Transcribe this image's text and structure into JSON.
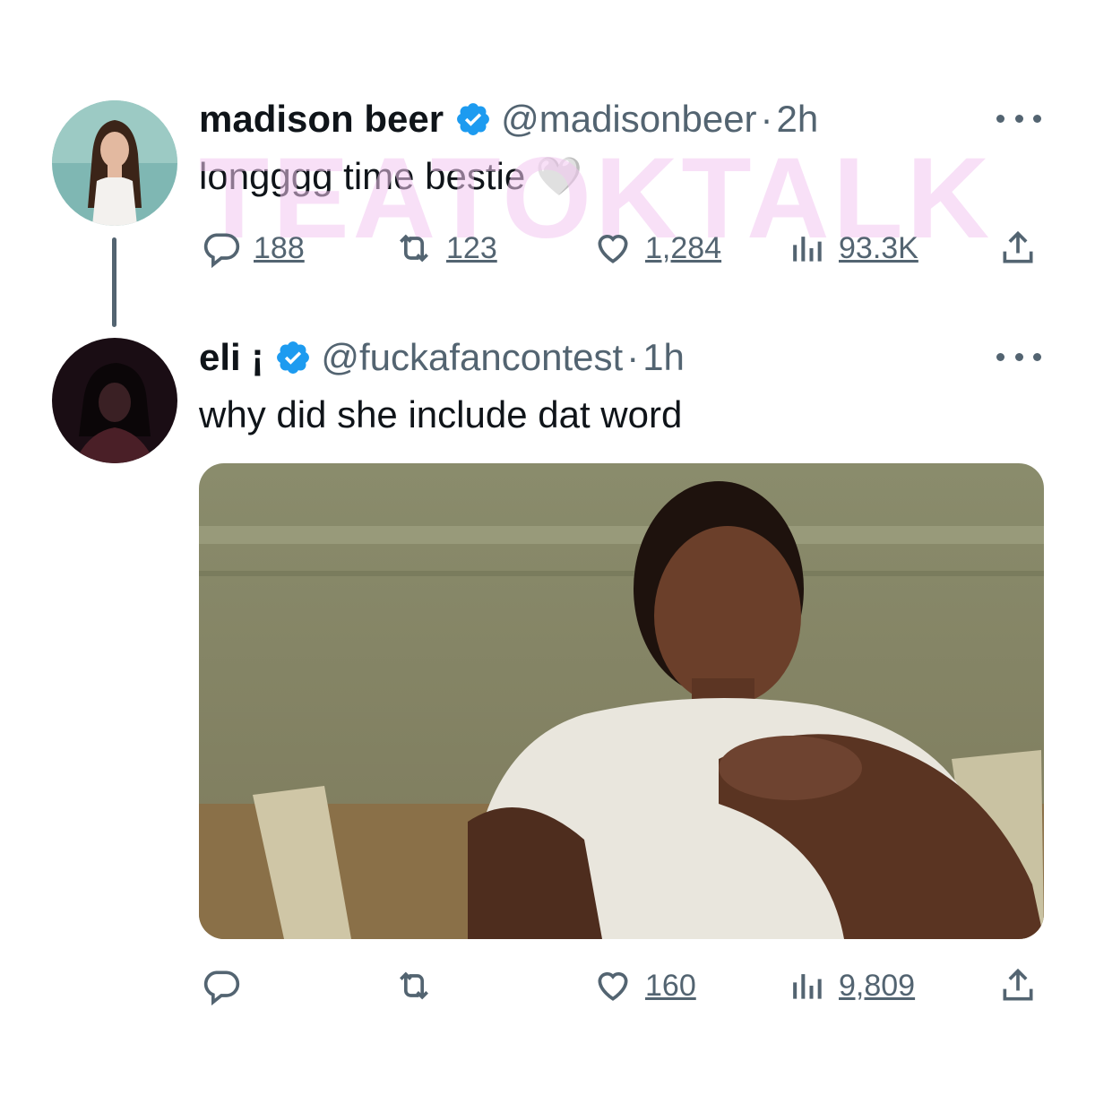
{
  "watermark": "TEATOKTALK",
  "tweets": [
    {
      "name": "madison beer",
      "handle": "@madisonbeer",
      "separator": "·",
      "time": "2h",
      "text": "longggg time bestie",
      "emoji": "🤍",
      "stats": {
        "replies": "188",
        "retweets": "123",
        "likes": "1,284",
        "views": "93.3K"
      }
    },
    {
      "name": "eli ¡",
      "handle": "@fuckafancontest",
      "separator": "·",
      "time": "1h",
      "text": "why did she include dat word",
      "stats": {
        "likes": "160",
        "views": "9,809"
      }
    }
  ],
  "colors": {
    "verified": "#1d9bf0",
    "muted": "#536471",
    "text": "#0f1419",
    "watermark": "#f3c8f1"
  },
  "icons": [
    "verified-badge-icon",
    "more-icon",
    "reply-icon",
    "retweet-icon",
    "like-icon",
    "views-icon",
    "share-icon"
  ]
}
